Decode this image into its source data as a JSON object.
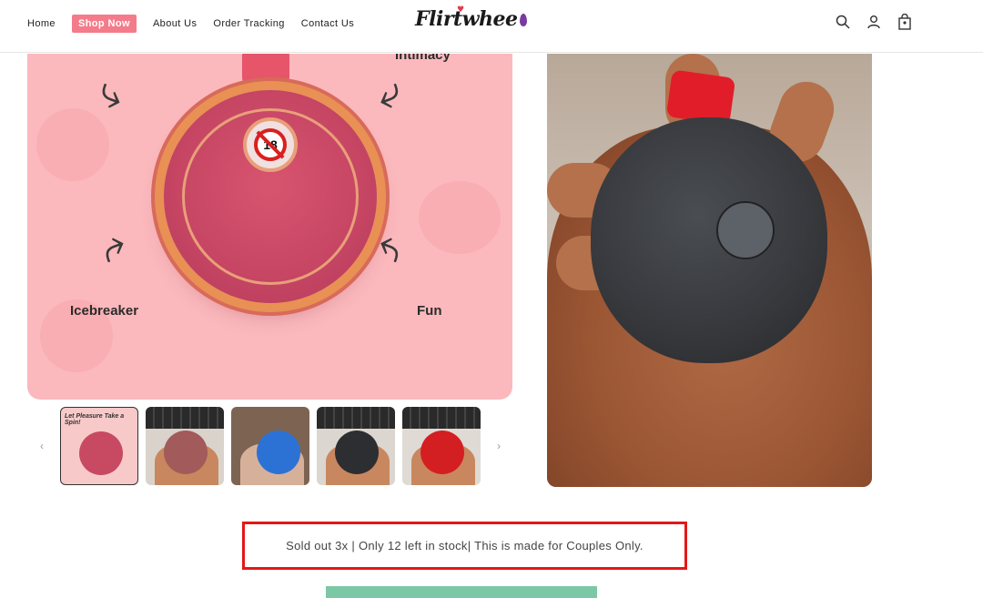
{
  "header": {
    "nav": [
      "Home",
      "Shop Now",
      "About Us",
      "Order Tracking",
      "Contact Us"
    ],
    "logo_text": "Flirtwhee",
    "icons": [
      "search-icon",
      "account-icon",
      "cart-icon"
    ]
  },
  "gallery": {
    "main_labels": {
      "top_right": "Intimacy",
      "bottom_left": "Icebreaker",
      "bottom_right": "Fun"
    },
    "badge_text": "18",
    "thumbnail_title": "Let Pleasure Take a Spin!",
    "thumbnail_count": 5,
    "prev": "‹",
    "next": "›"
  },
  "notice": {
    "text": "Sold out 3x | Only 12 left in stock| This is made for Couples Only."
  },
  "colors": {
    "accent": "#f47c8a",
    "notice_border": "#e51717",
    "pink_bg": "#fbb9bd"
  }
}
